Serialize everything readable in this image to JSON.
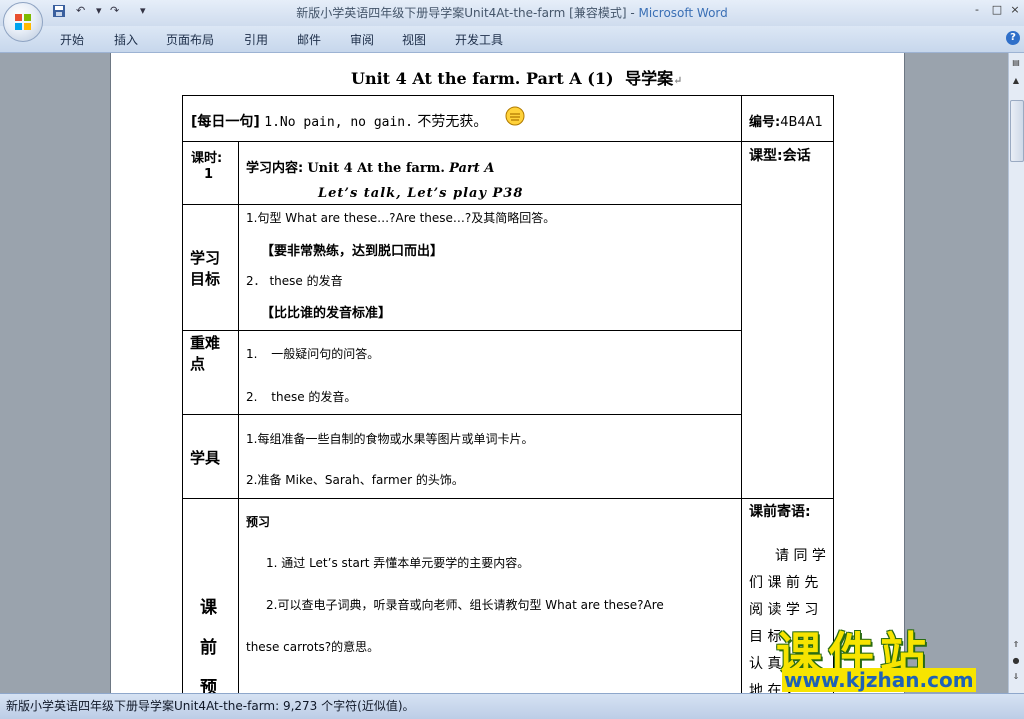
{
  "window": {
    "title_doc": "新版小学英语四年级下册导学案Unit4At-the-farm [兼容模式]",
    "title_sep": " - ",
    "title_app": "Microsoft Word",
    "min": "-",
    "max": "□",
    "close": "×"
  },
  "quick_access": {
    "save_icon": "save-icon",
    "undo": "↶",
    "redo": "↷",
    "more": "▾"
  },
  "ribbon": {
    "tabs": [
      "开始",
      "插入",
      "页面布局",
      "引用",
      "邮件",
      "审阅",
      "视图",
      "开发工具"
    ],
    "help": "?"
  },
  "document": {
    "heading_en": "Unit 4 At the farm. Part A (1)",
    "heading_cn": "导学案",
    "para_mark": "↵",
    "row1": {
      "daily_label": "[每日一句]",
      "daily_text": "1.No pain, no gain.",
      "daily_cn": "不劳无获。",
      "code_label": "编号:",
      "code_value": "4B4A1"
    },
    "row2": {
      "period_label_1": "课时:",
      "period_label_2": "1",
      "content_label": "学习内容:",
      "content_unit": "Unit 4 At the farm.",
      "content_part": "Part A",
      "content_line2": "Let’s talk, Let’s play P38",
      "type_label": "课型:会话"
    },
    "row3": {
      "label_1": "学习",
      "label_2": "目标",
      "goal1": "1.句型 What are these…?Are these…?及其简略回答。",
      "goal1_note": "【要非常熟练，达到脱口而出】",
      "goal2_num": "2．",
      "goal2": "these 的发音",
      "goal2_note": "【比比谁的发音标准】"
    },
    "row4": {
      "label_1": "重难",
      "label_2": "点",
      "item1_num": "1.",
      "item1": "一般疑问句的问答。",
      "item2_num": "2.",
      "item2": "these 的发音。"
    },
    "row5": {
      "label": "学具",
      "item1": "1.每组准备一些自制的食物或水果等图片或单词卡片。",
      "item2": "2.准备 Mike、Sarah、farmer 的头饰。"
    },
    "row6": {
      "label_chars": [
        "课",
        "前",
        "预"
      ],
      "section": "预习",
      "step1": "1. 通过 Let’s start 弄懂本单元要学的主要内容。",
      "step2_a": "2.可以查电子词典，听录音或向老师、组长请教句型  What  are  these?Are",
      "step2_b": "these carrots?的意思。",
      "note_label": "课前寄语:",
      "note_lines": [
        "请 同 学",
        "们 课 前 先",
        "阅 读 学 习",
        "目 标 ，",
        "认 真",
        "地 在 ，"
      ]
    }
  },
  "status": {
    "text": "新版小学英语四年级下册导学案Unit4At-the-farm: 9,273 个字符(近似值)。"
  },
  "watermark": {
    "brand": "课件站",
    "url": "www.kjzhan.com"
  }
}
